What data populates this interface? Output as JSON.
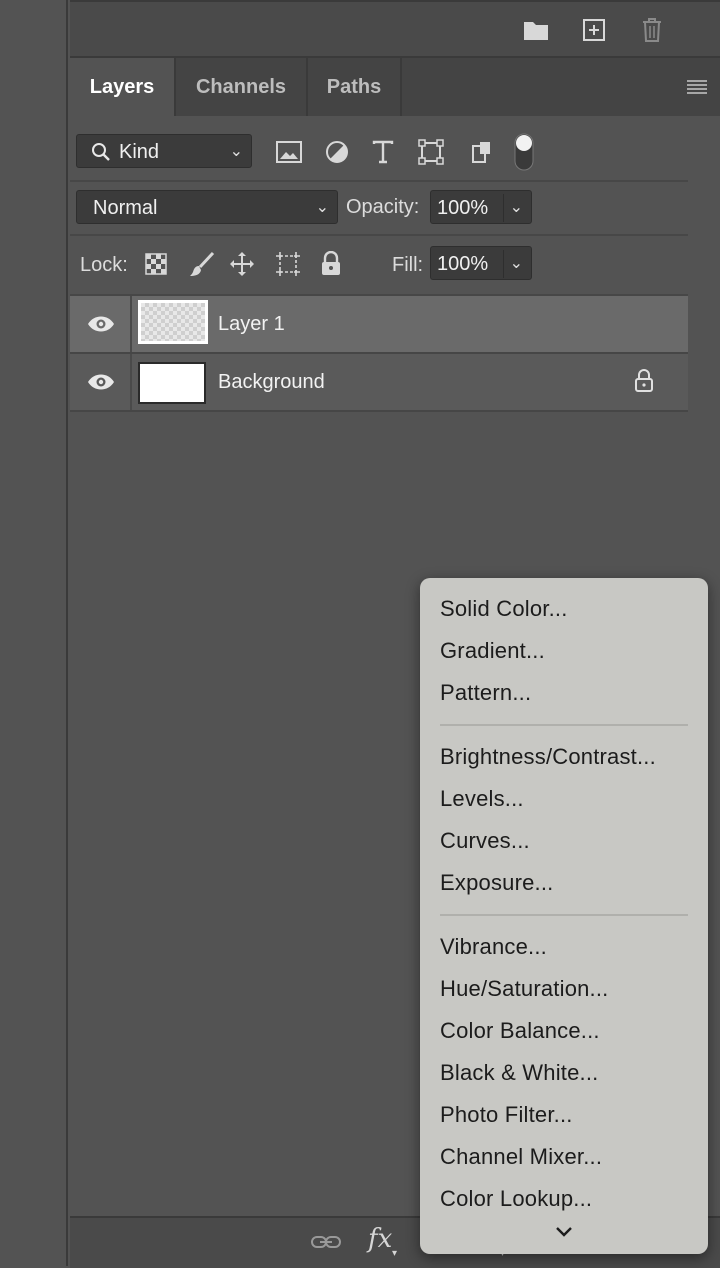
{
  "tabs": [
    {
      "label": "Layers"
    },
    {
      "label": "Channels"
    },
    {
      "label": "Paths"
    }
  ],
  "filter": {
    "kind_label": "Kind"
  },
  "blend": {
    "mode": "Normal",
    "opacity_label": "Opacity:",
    "opacity_value": "100%"
  },
  "lock": {
    "label": "Lock:",
    "fill_label": "Fill:",
    "fill_value": "100%"
  },
  "layers": [
    {
      "name": "Layer 1"
    },
    {
      "name": "Background"
    }
  ],
  "menu": {
    "items": [
      "Solid Color...",
      "Gradient...",
      "Pattern...",
      "Brightness/Contrast...",
      "Levels...",
      "Curves...",
      "Exposure...",
      "Vibrance...",
      "Hue/Saturation...",
      "Color Balance...",
      "Black & White...",
      "Photo Filter...",
      "Channel Mixer...",
      "Color Lookup..."
    ]
  },
  "bottom": {
    "fx_label": "fx"
  }
}
